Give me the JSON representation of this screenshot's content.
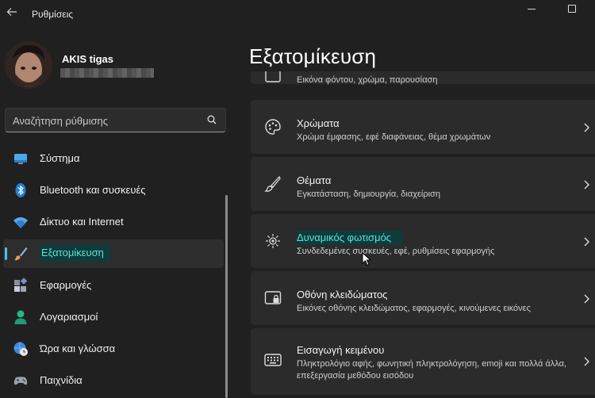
{
  "app": {
    "title": "Ρυθμίσεις"
  },
  "user": {
    "name": "AKIS tigas"
  },
  "search": {
    "placeholder": "Αναζήτηση ρύθμισης"
  },
  "nav": [
    {
      "label": "Σύστημα",
      "icon": "monitor-icon"
    },
    {
      "label": "Bluetooth και συσκευές",
      "icon": "bluetooth-icon"
    },
    {
      "label": "Δίκτυο και Internet",
      "icon": "wifi-icon"
    },
    {
      "label": "Εξατομίκευση",
      "icon": "brush-icon",
      "selected": true
    },
    {
      "label": "Εφαρμογές",
      "icon": "apps-icon"
    },
    {
      "label": "Λογαριασμοί",
      "icon": "person-icon"
    },
    {
      "label": "Ώρα και γλώσσα",
      "icon": "globe-clock-icon"
    },
    {
      "label": "Παιχνίδια",
      "icon": "gamepad-icon"
    }
  ],
  "page": {
    "title": "Εξατομίκευση"
  },
  "cards": [
    {
      "title": "",
      "subtitle": "Εικόνα φόντου, χρώμα, παρουσίαση",
      "icon": "image-icon"
    },
    {
      "title": "Χρώματα",
      "subtitle": "Χρώμα έμφασης, εφέ διαφάνειας, θέμα χρωμάτων",
      "icon": "palette-icon"
    },
    {
      "title": "Θέματα",
      "subtitle": "Εγκατάσταση, δημιουργία, διαχείριση",
      "icon": "brush-icon"
    },
    {
      "title": "Δυναμικός φωτισμός",
      "subtitle": "Συνδεδεμένες συσκευές, εφέ, ρυθμίσεις εφαρμογής",
      "icon": "sun-icon"
    },
    {
      "title": "Οθόνη κλειδώματος",
      "subtitle": "Εικόνες οθόνης κλειδώματος, εφαρμογές, κινούμενες εικόνες",
      "icon": "lock-screen-icon"
    },
    {
      "title": "Εισαγωγή κειμένου",
      "subtitle": "Πληκτρολόγιο αφής, φωνητική πληκτρολόγηση, emoji και πολλά άλλα, επεξεργασία μεθόδου εισόδου",
      "icon": "keyboard-icon"
    }
  ],
  "colors": {
    "accent": "#4cc2ff",
    "highlight": "#5fe0d9",
    "background": "#202020",
    "card": "#2b2b2b"
  }
}
